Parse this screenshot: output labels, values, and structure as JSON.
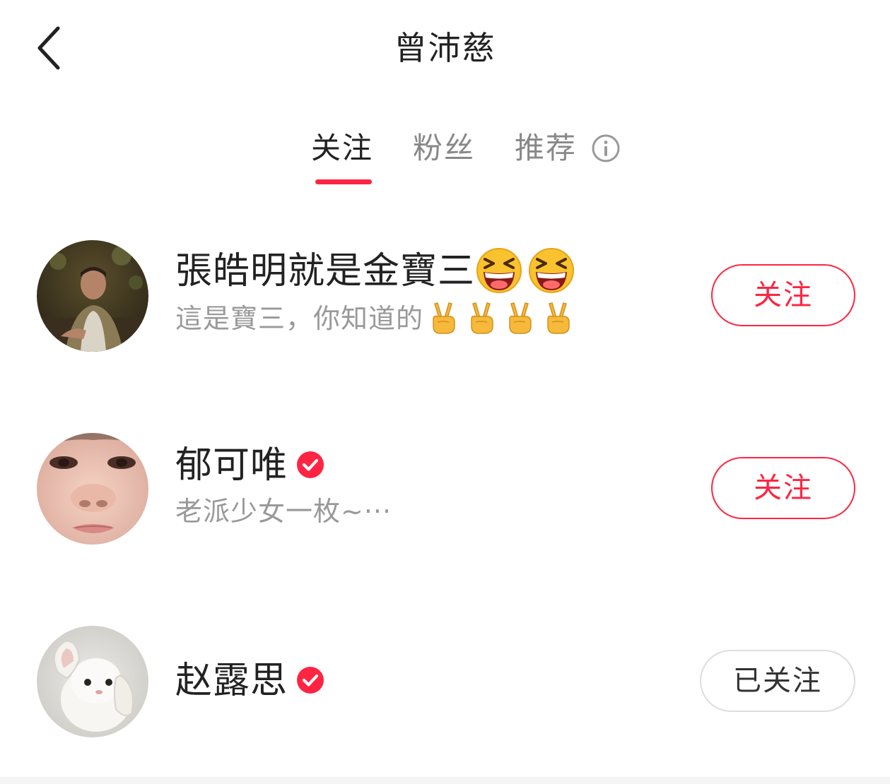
{
  "header": {
    "title": "曾沛慈"
  },
  "tabs": [
    {
      "label": "关注",
      "active": true
    },
    {
      "label": "粉丝",
      "active": false
    },
    {
      "label": "推荐",
      "active": false
    }
  ],
  "users": [
    {
      "name": "張皓明就是金寶三",
      "name_emojis": [
        "grinning-squint-emoji",
        "grinning-squint-emoji"
      ],
      "description": "這是寶三，你知道的",
      "description_emojis": [
        "victory-hand-emoji",
        "victory-hand-emoji",
        "victory-hand-emoji",
        "victory-hand-emoji"
      ],
      "verified": false,
      "button_label": "关注"
    },
    {
      "name": "郁可唯",
      "description": "老派少女一枚~···",
      "verified": true,
      "button_label": "关注"
    },
    {
      "name": "赵露思",
      "description": "",
      "verified": true,
      "button_label": "已关注"
    }
  ],
  "colors": {
    "accent": "#ff2442",
    "text_primary": "#222222",
    "text_secondary": "#999999"
  },
  "icons": {
    "back": "chevron-left-icon",
    "info": "info-circle-icon",
    "verified": "verified-check-icon"
  }
}
